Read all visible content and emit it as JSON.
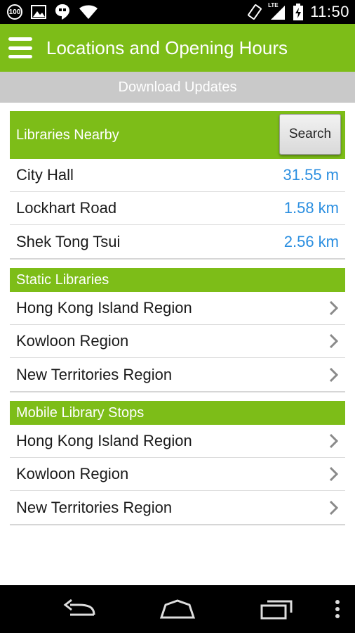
{
  "status_bar": {
    "notification_badge": "100",
    "network": "LTE",
    "time": "11:50"
  },
  "action_bar": {
    "title": "Locations and Opening Hours"
  },
  "download_bar": {
    "label": "Download Updates"
  },
  "nearby": {
    "header": "Libraries Nearby",
    "search_label": "Search",
    "items": [
      {
        "name": "City Hall",
        "distance": "31.55 m"
      },
      {
        "name": "Lockhart Road",
        "distance": "1.58 km"
      },
      {
        "name": "Shek Tong Tsui",
        "distance": "2.56 km"
      }
    ]
  },
  "static_libraries": {
    "header": "Static Libraries",
    "items": [
      {
        "label": "Hong Kong Island Region"
      },
      {
        "label": "Kowloon Region"
      },
      {
        "label": "New Territories Region"
      }
    ]
  },
  "mobile_stops": {
    "header": "Mobile Library Stops",
    "items": [
      {
        "label": "Hong Kong Island Region"
      },
      {
        "label": "Kowloon Region"
      },
      {
        "label": "New Territories Region"
      }
    ]
  },
  "colors": {
    "accent_green": "#7dbd18",
    "distance_blue": "#2a8ee0",
    "download_gray": "#c9c9c9"
  },
  "icons": {
    "menu": "hamburger-icon",
    "chevron": "chevron-right-icon",
    "back": "back-icon",
    "home": "home-icon",
    "recents": "recents-icon",
    "overflow": "overflow-menu-icon"
  }
}
